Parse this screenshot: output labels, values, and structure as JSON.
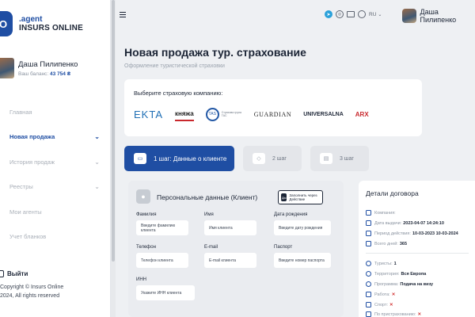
{
  "brand": {
    "line1": ".agent",
    "line2": "INSURS ONLINE",
    "mark": "O"
  },
  "user": {
    "name": "Даша Пилипенко",
    "balance_label": "Ваш баланс:",
    "balance_value": "43 754 ₴"
  },
  "menu": [
    {
      "label": "Главная",
      "has_chevron": false,
      "active": false
    },
    {
      "label": "Новая продажа",
      "has_chevron": true,
      "active": true
    },
    {
      "label": "История продаж",
      "has_chevron": true,
      "active": false
    },
    {
      "label": "Реестры",
      "has_chevron": true,
      "active": false
    },
    {
      "label": "Мои агенты",
      "has_chevron": false,
      "active": false
    },
    {
      "label": "Учет бланков",
      "has_chevron": false,
      "active": false
    }
  ],
  "logout_label": "Выйти",
  "copyright": {
    "line1": "Copyright © Insurs Online",
    "line2": "2024, All rights reserved"
  },
  "topbar": {
    "language": "RU",
    "user_name": "Даша Пилипенко"
  },
  "page": {
    "title": "Новая продажа тур. страхование",
    "subtitle": "Оформление туристической страховки"
  },
  "company_panel": {
    "title": "Выберите страховую компанию:",
    "companies": [
      "EKTA",
      "княжа",
      "Страхова група ТАС",
      "GUARDIAN",
      "UNIVERSALNA",
      "ARX"
    ]
  },
  "steps": [
    {
      "label": "1 шаг: Данные о клиенте",
      "active": true
    },
    {
      "label": "2 шаг",
      "active": false
    },
    {
      "label": "3 шаг",
      "active": false
    }
  ],
  "personal": {
    "title": "Персональные данные (Клиент)",
    "fill_button": "Заполнить через Действие",
    "fill_button_icon": "Дія",
    "fields": {
      "surname": {
        "label": "Фамилия",
        "placeholder": "Введите фамилию клиента"
      },
      "name": {
        "label": "Имя",
        "placeholder": "Имя клиента"
      },
      "birth": {
        "label": "Дата рождения",
        "placeholder": "Введите дату рождения"
      },
      "phone": {
        "label": "Телефон",
        "placeholder": "Телефон клиента"
      },
      "email": {
        "label": "E-mail",
        "placeholder": "E-mail клиента"
      },
      "passport": {
        "label": "Паспорт",
        "placeholder": "Введите номер паспорта"
      },
      "inn": {
        "label": "ИНН",
        "placeholder": "Укажите ИНН клиента"
      }
    }
  },
  "details": {
    "title": "Детали договора",
    "company_label": "Компания:",
    "issue_date_label": "Дата выдачи:",
    "issue_date": "2023-04-07 14:24:10",
    "period_label": "Период действия:",
    "period": "10-03-2023 10-03-2024",
    "days_label": "Всего дней:",
    "days": "365",
    "tourists_label": "Туристы:",
    "tourists": "1",
    "territory_label": "Территория:",
    "territory": "Вся Европа",
    "program_label": "Программа:",
    "program": "Подача на визу",
    "work_label": "Работа:",
    "sport_label": "Спорт:",
    "rest_label": "По пристрахованию:",
    "no_mark": "✕"
  }
}
